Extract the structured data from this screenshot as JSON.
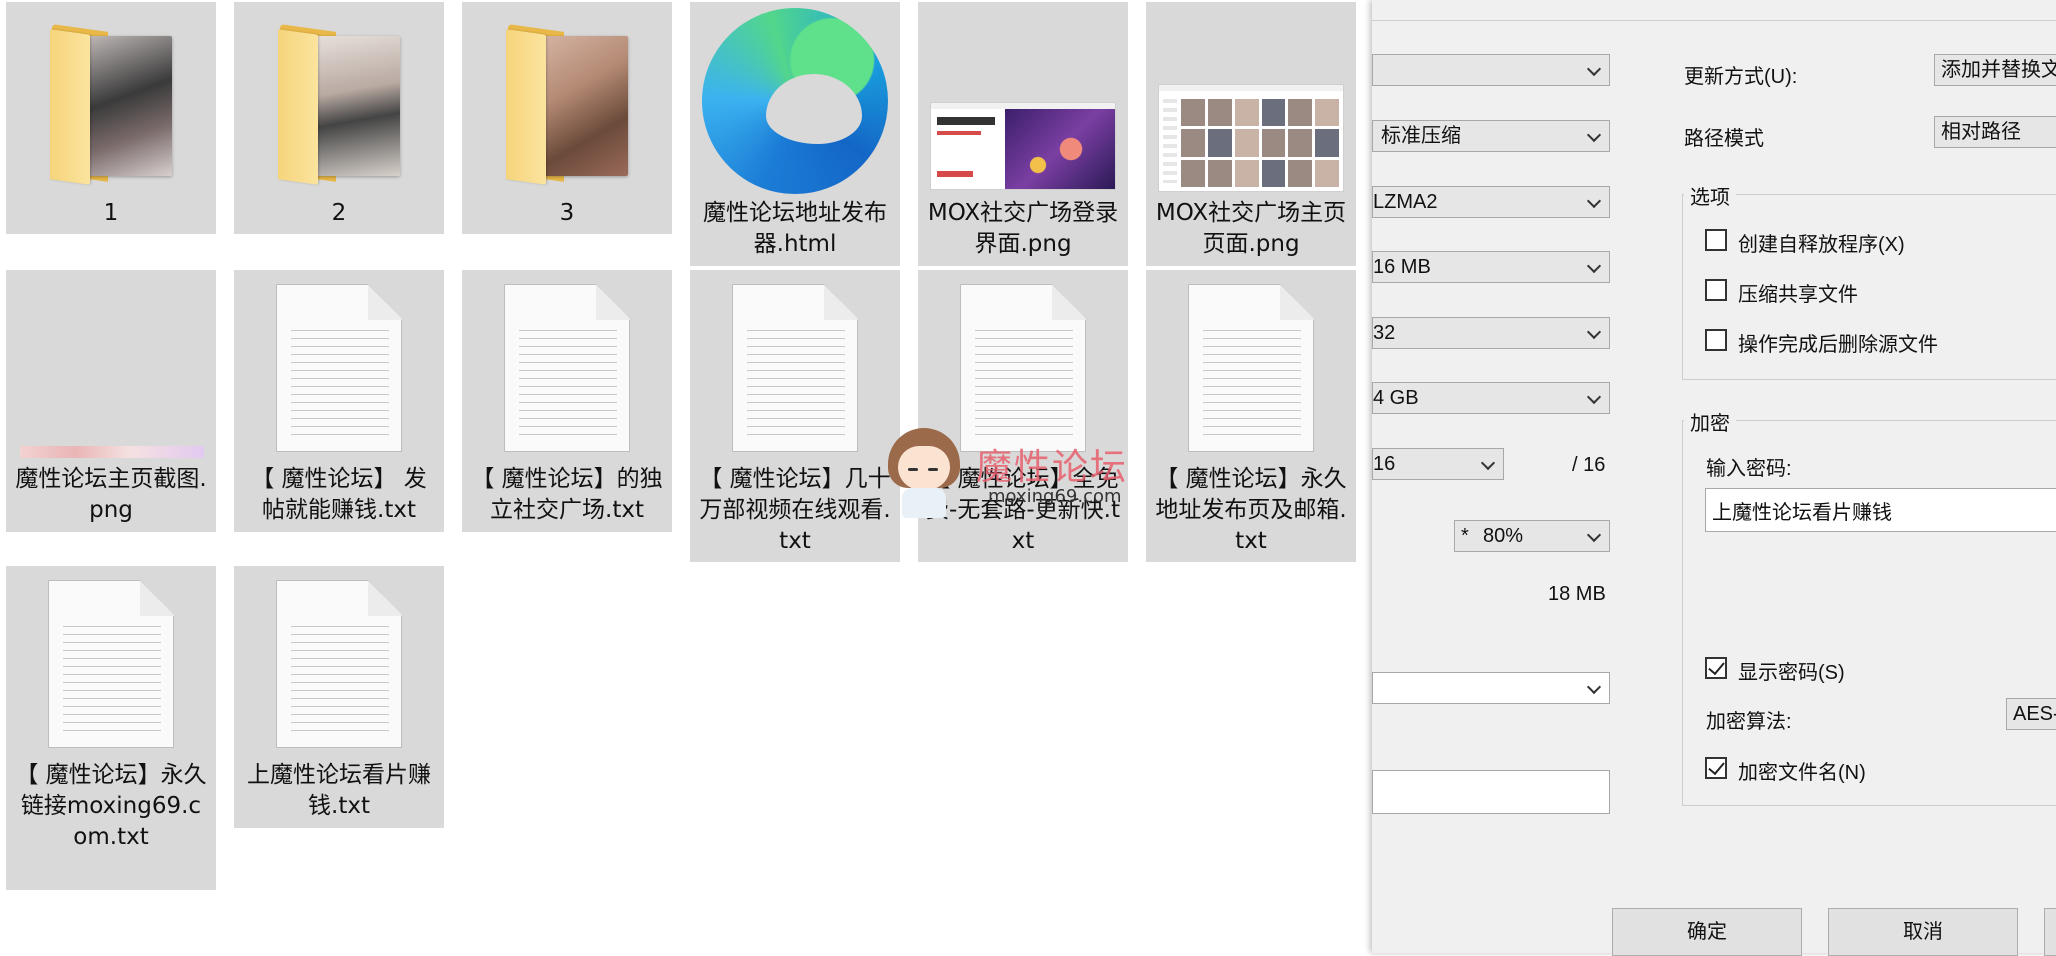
{
  "explorer": {
    "items": [
      {
        "name": "1",
        "type": "folder"
      },
      {
        "name": "2",
        "type": "folder"
      },
      {
        "name": "3",
        "type": "folder"
      },
      {
        "name": "魔性论坛地址发布器.html",
        "type": "html"
      },
      {
        "name": "MOX社交广场登录界面.png",
        "type": "png"
      },
      {
        "name": "MOX社交广场主页页面.png",
        "type": "png"
      },
      {
        "name": "魔性论坛主页截图.png",
        "type": "png"
      },
      {
        "name": "【 魔性论坛】 发帖就能赚钱.txt",
        "type": "txt"
      },
      {
        "name": "【 魔性论坛】的独立社交广场.txt",
        "type": "txt"
      },
      {
        "name": "【 魔性论坛】几十万部视频在线观看.txt",
        "type": "txt"
      },
      {
        "name": "【 魔性论坛】全免费-无套路-更新快.txt",
        "type": "txt"
      },
      {
        "name": "【 魔性论坛】永久地址发布页及邮箱.txt",
        "type": "txt"
      },
      {
        "name": "【 魔性论坛】永久链接moxing69.com.txt",
        "type": "txt"
      },
      {
        "name": "上魔性论坛看片赚钱.txt",
        "type": "txt"
      }
    ],
    "thumb_text": {
      "login_title": "欢迎来到 MOX"
    }
  },
  "watermark": {
    "title": "魔性论坛",
    "url": "moxing69.com"
  },
  "dialog": {
    "combos": {
      "format": "",
      "level": "标准压缩",
      "method": "LZMA2",
      "dict": "16 MB",
      "word": "32",
      "block": "4 GB",
      "threads": "16",
      "memory": "80%",
      "volume": ""
    },
    "threads_total": "/ 16",
    "memory_prefix": "*",
    "memory_total": "18 MB",
    "update_mode_label": "更新方式(U):",
    "update_mode_value": "添加并替换文",
    "path_mode_label": "路径模式",
    "path_mode_value": "相对路径",
    "options_title": "选项",
    "options": [
      {
        "label": "创建自释放程序(X)",
        "checked": false
      },
      {
        "label": "压缩共享文件",
        "checked": false
      },
      {
        "label": "操作完成后删除源文件",
        "checked": false
      }
    ],
    "encryption_title": "加密",
    "password_label": "输入密码:",
    "password_value": "上魔性论坛看片赚钱",
    "show_password": {
      "label": "显示密码(S)",
      "checked": true
    },
    "algorithm_label": "加密算法:",
    "algorithm_value": "AES-",
    "encrypt_names": {
      "label": "加密文件名(N)",
      "checked": true
    },
    "ok_label": "确定",
    "cancel_label": "取消"
  }
}
